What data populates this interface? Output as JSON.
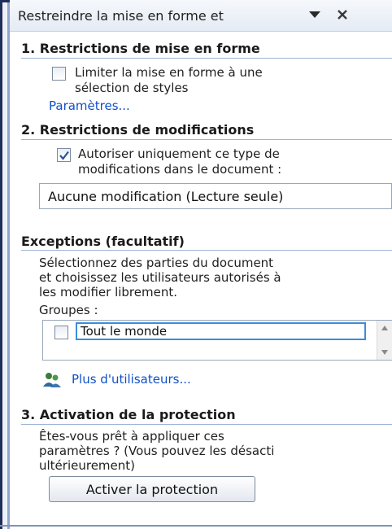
{
  "pane": {
    "title": "Restreindre la mise en forme et",
    "icons": {
      "dropdown": "chevron-down-icon",
      "close": "close-icon",
      "users": "users-icon"
    }
  },
  "section1": {
    "heading": "1. Restrictions de mise en forme",
    "checkbox_checked": false,
    "checkbox_label_line1": "Limiter la mise en forme à une",
    "checkbox_label_line2": "sélection de styles",
    "link": "Paramètres..."
  },
  "section2": {
    "heading": "2. Restrictions de modifications",
    "checkbox_checked": true,
    "checkbox_label_line1": "Autoriser uniquement ce type de",
    "checkbox_label_line2": "modifications dans le document :",
    "selected_value": "Aucune modification (Lecture seule)",
    "exceptions_heading": "Exceptions (facultatif)",
    "exceptions_text_line1": "Sélectionnez des parties du document",
    "exceptions_text_line2": "et choisissez les utilisateurs autorisés à",
    "exceptions_text_line3": "les modifier librement.",
    "groups_label": "Groupes :",
    "groups": [
      {
        "label": "Tout le monde",
        "checked": false
      }
    ],
    "more_users_link": "Plus d'utilisateurs..."
  },
  "section3": {
    "heading": "3. Activation de la protection",
    "text_line1": "Êtes-vous prêt à appliquer ces",
    "text_line2": "paramètres ? (Vous pouvez les désacti",
    "text_line3": "ultérieurement)",
    "button_label": "Activer la protection"
  },
  "colors": {
    "link": "#1050c8",
    "section_rule": "#9fb4d3",
    "focus_border": "#3a8ddc",
    "checkmark": "#2b4f9e"
  }
}
